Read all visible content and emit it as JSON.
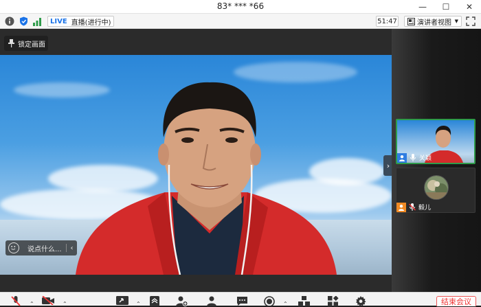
{
  "window": {
    "title": "83* *** *66",
    "minimize": "—",
    "maximize": "☐",
    "close": "✕"
  },
  "infobar": {
    "live_label": "LIVE",
    "live_status": "直播(进行中)",
    "timer": "51:47",
    "view_label": "演讲者视图"
  },
  "main": {
    "lock_label": "锁定画面",
    "chat_placeholder": "说点什么...",
    "chat_collapse": "‹",
    "panel_collapse": "›"
  },
  "participants": [
    {
      "name": "关颖",
      "active": true
    },
    {
      "name": "毅儿",
      "active": false
    }
  ],
  "toolbar": {
    "end_label": "结束会议"
  },
  "colors": {
    "live_blue": "#1a73e8",
    "active_green": "#2e9b4a",
    "end_red": "#e33333",
    "badge_blue": "#2f7de1",
    "badge_orange": "#f08a24"
  }
}
